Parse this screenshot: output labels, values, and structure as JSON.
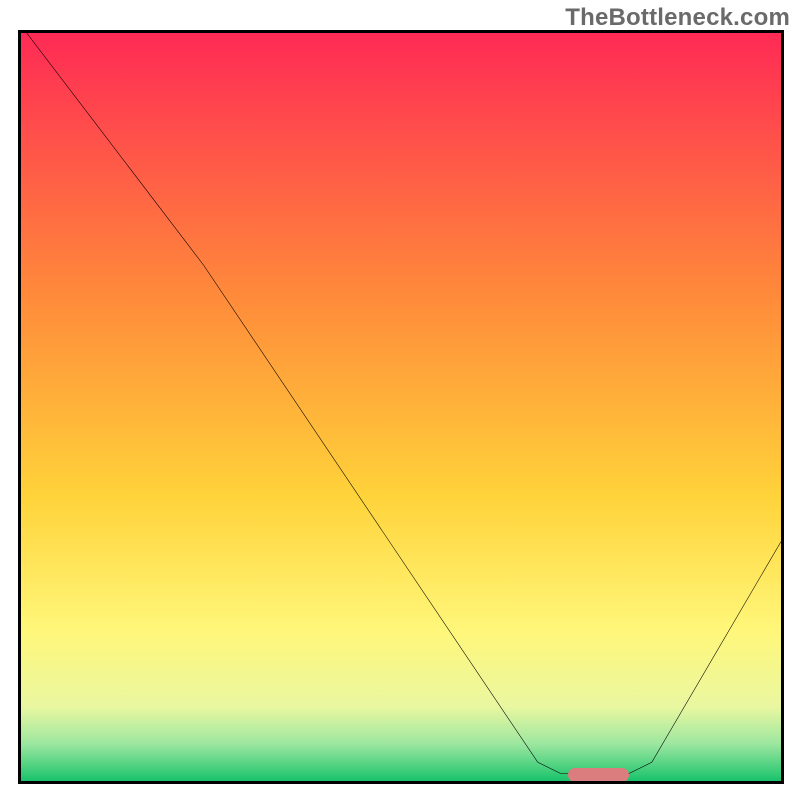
{
  "watermark": "TheBottleneck.com",
  "chart_data": {
    "type": "line",
    "title": "",
    "xlabel": "",
    "ylabel": "",
    "xlim": [
      0,
      100
    ],
    "ylim": [
      0,
      100
    ],
    "grid": false,
    "curve": [
      {
        "x": 0,
        "y": 101
      },
      {
        "x": 24,
        "y": 69
      },
      {
        "x": 68,
        "y": 2.5
      },
      {
        "x": 71,
        "y": 1.0
      },
      {
        "x": 80,
        "y": 1.0
      },
      {
        "x": 83,
        "y": 2.5
      },
      {
        "x": 100,
        "y": 32
      }
    ],
    "marker": {
      "x_start": 72,
      "x_end": 80,
      "y": 0.8
    },
    "background_gradient": [
      {
        "stop": 0.0,
        "color": "#ff2a55"
      },
      {
        "stop": 0.35,
        "color": "#ff8a3a"
      },
      {
        "stop": 0.62,
        "color": "#ffd33a"
      },
      {
        "stop": 0.8,
        "color": "#fff77a"
      },
      {
        "stop": 0.9,
        "color": "#eaf7a0"
      },
      {
        "stop": 0.95,
        "color": "#9de7a0"
      },
      {
        "stop": 1.0,
        "color": "#19c36b"
      }
    ]
  }
}
